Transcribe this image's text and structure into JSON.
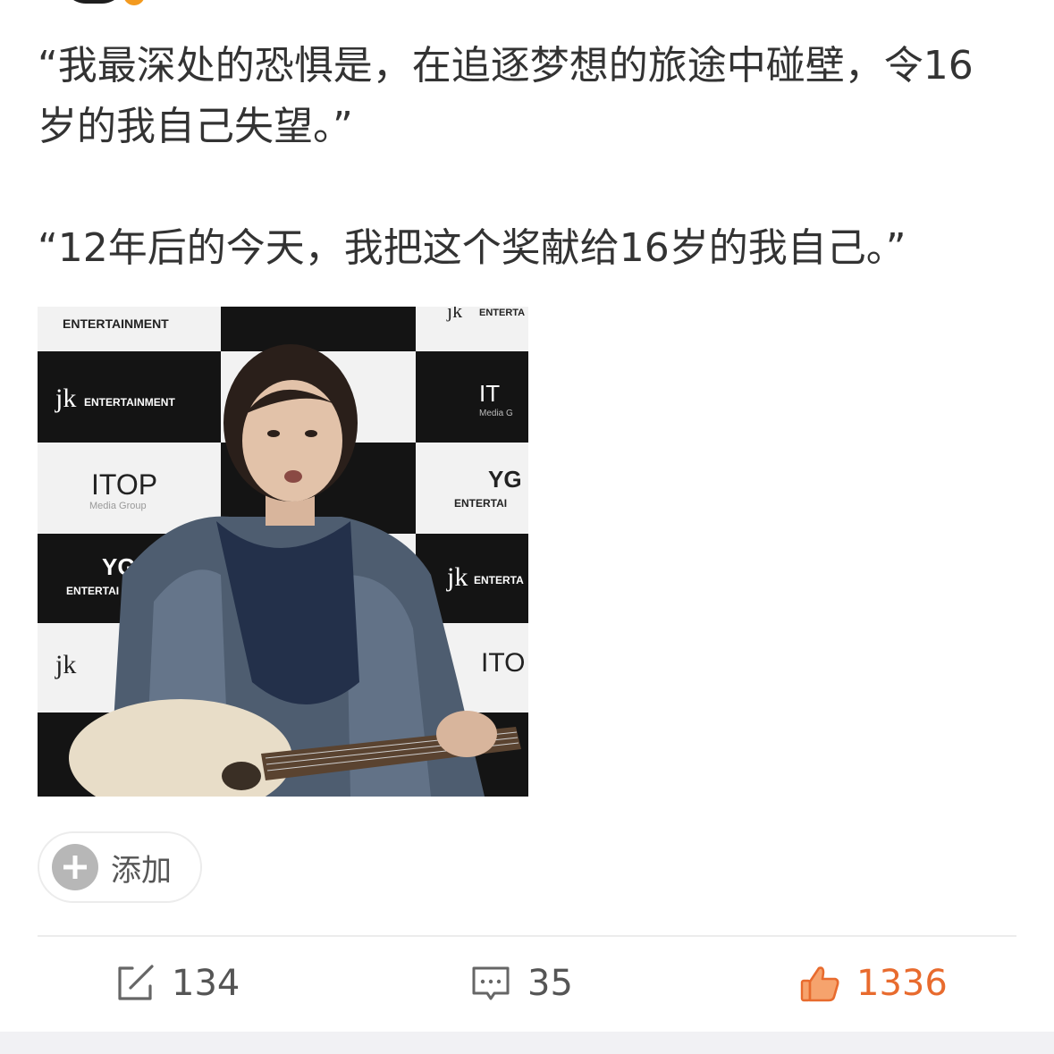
{
  "post": {
    "paragraphs": [
      "“我最深处的恐惧是，在追逐梦想的旅途中碰壁，令16岁的我自己失望。”",
      "“12年后的今天，我把这个奖献给16岁的我自己。”"
    ]
  },
  "media": {
    "backdrop_logos": [
      "ENTERTAINMENT",
      "jk ENTERTAINMENT",
      "ITOP",
      "Media Group",
      "YG",
      "ENTERTAI"
    ]
  },
  "add_button": {
    "label": "添加",
    "icon": "plus-icon"
  },
  "actions": {
    "share": {
      "icon": "share-icon",
      "count": "134"
    },
    "comment": {
      "icon": "comment-icon",
      "count": "35"
    },
    "like": {
      "icon": "thumbs-up-icon",
      "count": "1336",
      "color": "#e86b2e"
    }
  },
  "colors": {
    "accent": "#e86b2e",
    "text": "#333333",
    "muted": "#555555"
  }
}
